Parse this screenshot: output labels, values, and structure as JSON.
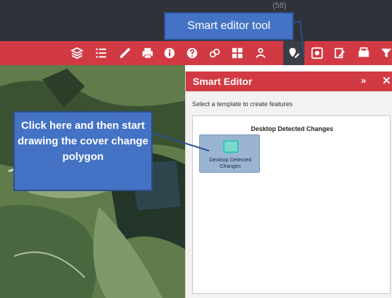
{
  "header": {
    "fragment_left": "",
    "fragment_right": "(58)"
  },
  "toolbar": {
    "tools": [
      {
        "icon": "layers-icon"
      },
      {
        "icon": "list-icon"
      },
      {
        "icon": "ruler-icon"
      },
      {
        "icon": "print-icon"
      },
      {
        "icon": "info-icon"
      },
      {
        "icon": "help-icon"
      },
      {
        "icon": "share-icon"
      },
      {
        "icon": "widget-grid-icon"
      },
      {
        "icon": "analysis-icon"
      },
      {
        "icon": "smart-editor-icon",
        "active": true
      },
      {
        "icon": "screening-icon"
      },
      {
        "icon": "report-icon"
      },
      {
        "icon": "print-plus-icon"
      },
      {
        "icon": "filter-icon"
      }
    ],
    "color": "#d23a43"
  },
  "callouts": {
    "top": "Smart editor tool",
    "left": "Click here and then start drawing the cover change polygon",
    "color": "#4473c5"
  },
  "panel": {
    "title": "Smart Editor",
    "collapse_glyph": "»",
    "close_glyph": "✕",
    "hint": "Select a template to create features",
    "group_title": "Desktop Detected Changes",
    "template_label": "Desktop Detected Changes"
  }
}
